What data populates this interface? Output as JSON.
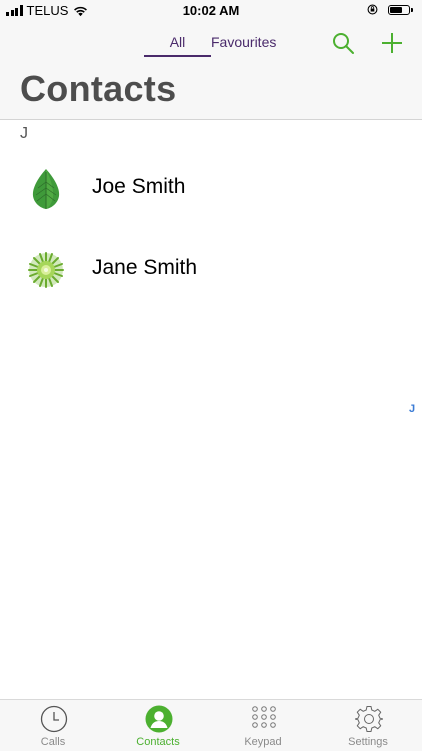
{
  "status_bar": {
    "carrier": "TELUS",
    "time": "10:02 AM"
  },
  "header": {
    "segments": [
      {
        "label": "All",
        "selected": true
      },
      {
        "label": "Favourites",
        "selected": false
      }
    ],
    "title": "Contacts",
    "icons": [
      "search-icon",
      "plus-icon"
    ]
  },
  "contacts": {
    "section_letter": "J",
    "items": [
      {
        "name": "Joe Smith",
        "avatar": "leaf-avatar"
      },
      {
        "name": "Jane Smith",
        "avatar": "flower-avatar"
      }
    ],
    "index": [
      "J"
    ]
  },
  "tab_bar": {
    "tabs": [
      {
        "label": "Calls",
        "icon": "clock-icon",
        "active": false
      },
      {
        "label": "Contacts",
        "icon": "person-icon",
        "active": true
      },
      {
        "label": "Keypad",
        "icon": "keypad-icon",
        "active": false
      },
      {
        "label": "Settings",
        "icon": "gear-icon",
        "active": false
      }
    ]
  },
  "colors": {
    "accent_green": "#4cb030",
    "accent_purple": "#4a2a6b",
    "index_blue": "#3a7bd5",
    "title_gray": "#4d4d4d"
  }
}
